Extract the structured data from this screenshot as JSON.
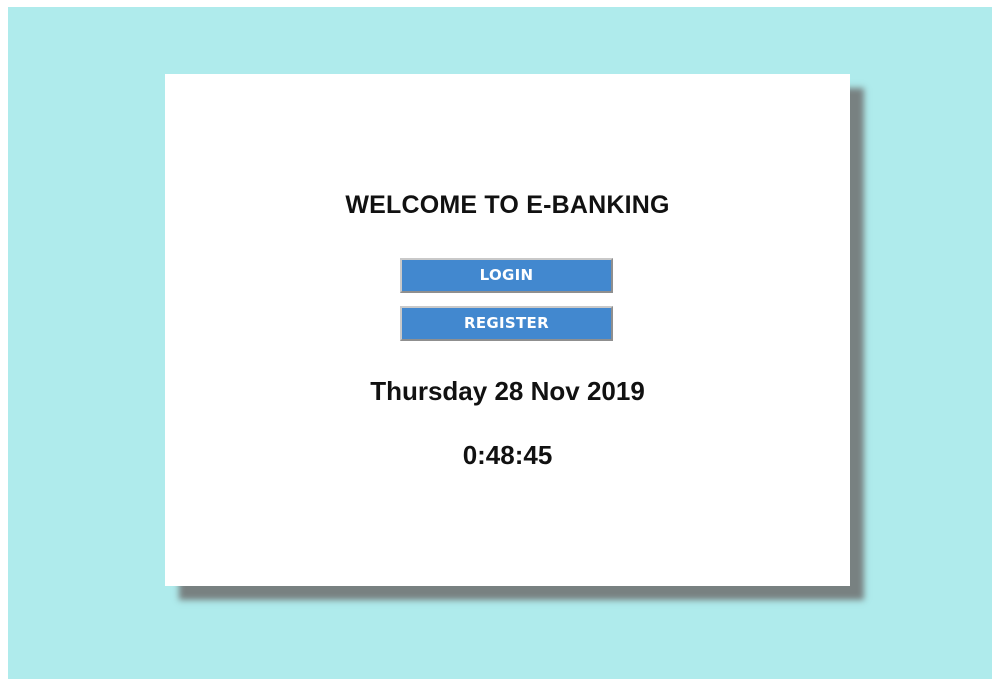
{
  "colors": {
    "page_background": "#afebec",
    "card_background": "#ffffff",
    "button_background": "#4288cf",
    "button_text": "#ffffff",
    "text": "#111111"
  },
  "welcome": {
    "title": "WELCOME TO E-BANKING"
  },
  "actions": {
    "login_label": "LOGIN",
    "register_label": "REGISTER"
  },
  "datetime": {
    "date": "Thursday 28 Nov 2019",
    "time": "0:48:45"
  }
}
